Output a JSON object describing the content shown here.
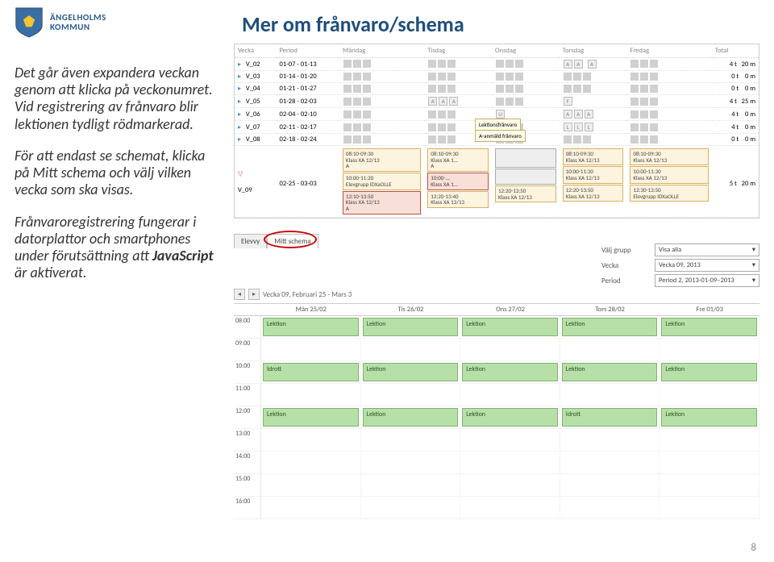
{
  "header": {
    "org_line1": "ÄNGELHOLMS",
    "org_line2": "KOMMUN",
    "title": "Mer om frånvaro/schema"
  },
  "left_text": {
    "p1": "Det går även expandera veckan genom att klicka på veckonumret. Vid registrering av frånvaro blir lektionen tydligt rödmarkerad.",
    "p2_a": "För att endast se schemat, klicka på ",
    "p2_b": "Mitt schema",
    "p2_c": " och välj vilken vecka som ska visas.",
    "p3_a": "Frånvaroregistrering fungerar i datorplattor och smartphones under förutsättning att ",
    "p3_b": "JavaScript",
    "p3_c": " är aktiverat."
  },
  "shot1": {
    "cols": [
      "Vecka",
      "Period",
      "Måndag",
      "Tisdag",
      "Onsdag",
      "Torsdag",
      "Fredag",
      "Total"
    ],
    "rows": [
      {
        "w": "V_02",
        "p": "01-07 - 01-13",
        "tot": "4 t   20 m"
      },
      {
        "w": "V_03",
        "p": "01-14 - 01-20",
        "tot": "0 t    0 m"
      },
      {
        "w": "V_04",
        "p": "01-21 - 01-27",
        "tot": "0 t    0 m"
      },
      {
        "w": "V_05",
        "p": "01-28 - 02-03",
        "tot": "4 t   25 m"
      },
      {
        "w": "V_06",
        "p": "02-04 - 02-10",
        "tot": "4 t    0 m"
      },
      {
        "w": "V_07",
        "p": "02-11 - 02-17",
        "tot": "4 t    0 m"
      },
      {
        "w": "V_08",
        "p": "02-18 - 02-24",
        "tot": "0 t    0 m"
      }
    ],
    "expandedWeek": "V_09",
    "expandedPeriod": "02-25 - 03-03",
    "expandedTotal": "5 t   20 m",
    "cards": {
      "mon1": "08:10-09:30\nKlass XA 12/13\nA",
      "mon2": "10:00-11:20\nElevgrupp IDXaOLLE",
      "mon3": "12:10-13:50\nKlass XA 12/13\nA",
      "tue1": "08:10-09:30\nKlass XA 1...\nA",
      "tue2": "10:00-...\nKlass XA 1...",
      "tue3": "12:20-13:40\nKlass XA 12/13",
      "wed1": "Lektionsfrånvaro",
      "wed2": "A-anmäld frånvaro",
      "wed3": "12:20-13:50\nKlass XA 12/13",
      "thu1": "08:10-09:30\nKlass XA 12/13",
      "thu2": "10:00-11:30\nKlass XA 12/13",
      "thu3": "12:20-13:50\nKlass XA 12/13",
      "fri1": "08:10-09:30\nKlass XA 12/13",
      "fri2": "10:00-11:30\nKlass XA 12/13",
      "fri3": "12:30-13:50\nElevgrupp IDXaOLLE"
    }
  },
  "shot2": {
    "tabs": {
      "elevvy": "Elevvy",
      "mitt": "Mitt schema"
    },
    "filters": {
      "grupp_label": "Välj grupp",
      "grupp_val": "Visa alla",
      "vecka_label": "Vecka",
      "vecka_val": "Vecka 09, 2013",
      "period_label": "Period",
      "period_val": "Period 2, 2013-01-09–2013"
    },
    "week_title": "Vecka 09, Februari 25 - Mars 3",
    "days": [
      "Mån 25/02",
      "Tis 26/02",
      "Ons 27/02",
      "Tors 28/02",
      "Fre 01/03"
    ],
    "times": [
      "08:00",
      "09:00",
      "10:00",
      "11:00",
      "12:00",
      "13:00",
      "14:00",
      "15:00",
      "16:00"
    ],
    "lektion": "Lektion",
    "idrott": "Idrott"
  },
  "pagenum": "8"
}
